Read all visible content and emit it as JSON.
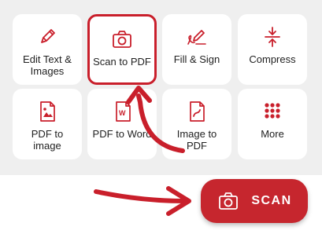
{
  "colors": {
    "accent": "#c6262e",
    "tile_bg": "#ffffff",
    "panel_bg": "#efefef"
  },
  "tools": [
    {
      "label": "Edit Text &\nImages",
      "icon": "pencil-icon"
    },
    {
      "label": "Scan to PDF",
      "icon": "camera-icon"
    },
    {
      "label": "Fill & Sign",
      "icon": "signature-pen-icon"
    },
    {
      "label": "Compress",
      "icon": "compress-icon"
    },
    {
      "label": "PDF to\nimage",
      "icon": "pdf-image-icon"
    },
    {
      "label": "PDF to Word",
      "icon": "pdf-word-icon"
    },
    {
      "label": "Image to\nPDF",
      "icon": "image-pdf-icon"
    },
    {
      "label": "More",
      "icon": "grid-dots-icon"
    }
  ],
  "scan_button": {
    "label": "SCAN",
    "icon": "camera-icon"
  }
}
